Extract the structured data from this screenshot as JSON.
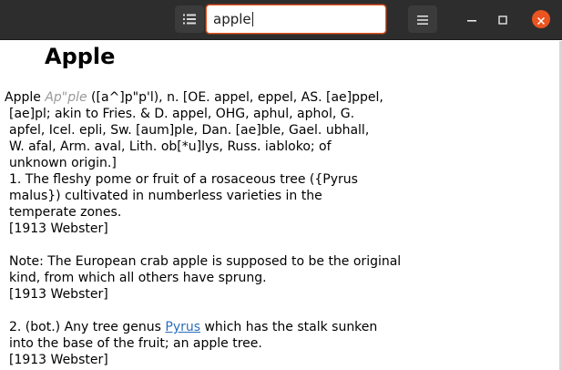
{
  "search": {
    "query": "apple"
  },
  "icons": {
    "list": "list-view-icon",
    "menu": "hamburger-menu-icon",
    "minimize": "minimize-icon",
    "maximize": "maximize-icon",
    "close": "close-icon"
  },
  "colors": {
    "accent": "#e95420",
    "headerbar": "#2d2d2d",
    "link": "#2a6ebb"
  },
  "entry": {
    "headword": "Apple",
    "lead_word": "Apple",
    "pronunciation": "Ap\"ple",
    "line1_rest": " ([a^]p\"p'l), n. [OE. appel, eppel, AS. [ae]ppel,",
    "etymology_lines": [
      "[ae]pl; akin to Fries. & D. appel, OHG, aphul, aphol, G.",
      "apfel, Icel. epli, Sw. [aum]ple, Dan. [ae]ble, Gael. ubhall,",
      "W. afal, Arm. aval, Lith. ob[*u]lys, Russ. iabloko; of",
      "unknown origin.]"
    ],
    "sense1_lines": [
      "1. The fleshy pome or fruit of a rosaceous tree ({Pyrus",
      "malus}) cultivated in numberless varieties in the",
      "temperate zones.",
      "[1913 Webster]"
    ],
    "note_lines": [
      "Note: The European crab apple is supposed to be the original",
      "kind, from which all others have sprung.",
      "[1913 Webster]"
    ],
    "sense2": {
      "prefix": "2. (bot.) Any tree genus ",
      "link": "Pyrus",
      "suffix": " which has the stalk sunken",
      "line2": "into the base of the fruit; an apple tree.",
      "source": "[1913 Webster]"
    }
  }
}
